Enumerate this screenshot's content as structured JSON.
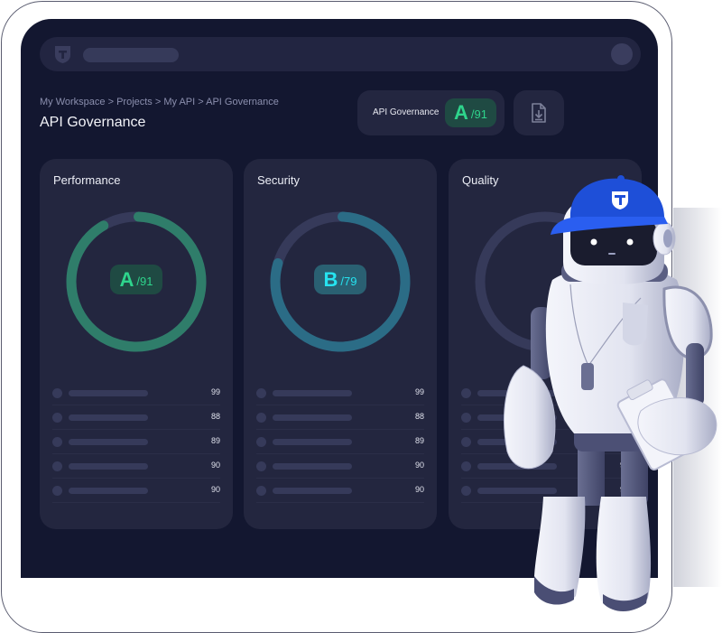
{
  "header": {
    "logo_icon": "shield-t-logo-icon",
    "search_placeholder": "",
    "avatar_icon": "user-avatar-icon"
  },
  "breadcrumb": "My Workspace > Projects > My API > API Governance",
  "page_title": "API Governance",
  "summary": {
    "label": "API Governance",
    "grade": "A",
    "score": "/91",
    "export_icon": "file-download-icon"
  },
  "colors": {
    "background": "#131730",
    "card": "#23263f",
    "grade_a": "#2ed48c",
    "ring_a": "#2f7d6a",
    "grade_b": "#26e3f0",
    "ring_b": "#2b6c86",
    "ring_track": "#363a5a",
    "hat_blue": "#1e4fd8"
  },
  "cards": [
    {
      "title": "Performance",
      "grade": "A",
      "score": "/91",
      "progress_percent": 91,
      "rows": [
        "99",
        "88",
        "89",
        "90",
        "90"
      ]
    },
    {
      "title": "Security",
      "grade": "B",
      "score": "/79",
      "progress_percent": 79,
      "rows": [
        "99",
        "88",
        "89",
        "90",
        "90"
      ]
    },
    {
      "title": "Quality",
      "grade": "",
      "score": "",
      "progress_percent": 0,
      "rows": [
        "",
        "",
        "",
        "90",
        "90"
      ]
    }
  ],
  "mascot": "robot-coach-mascot"
}
